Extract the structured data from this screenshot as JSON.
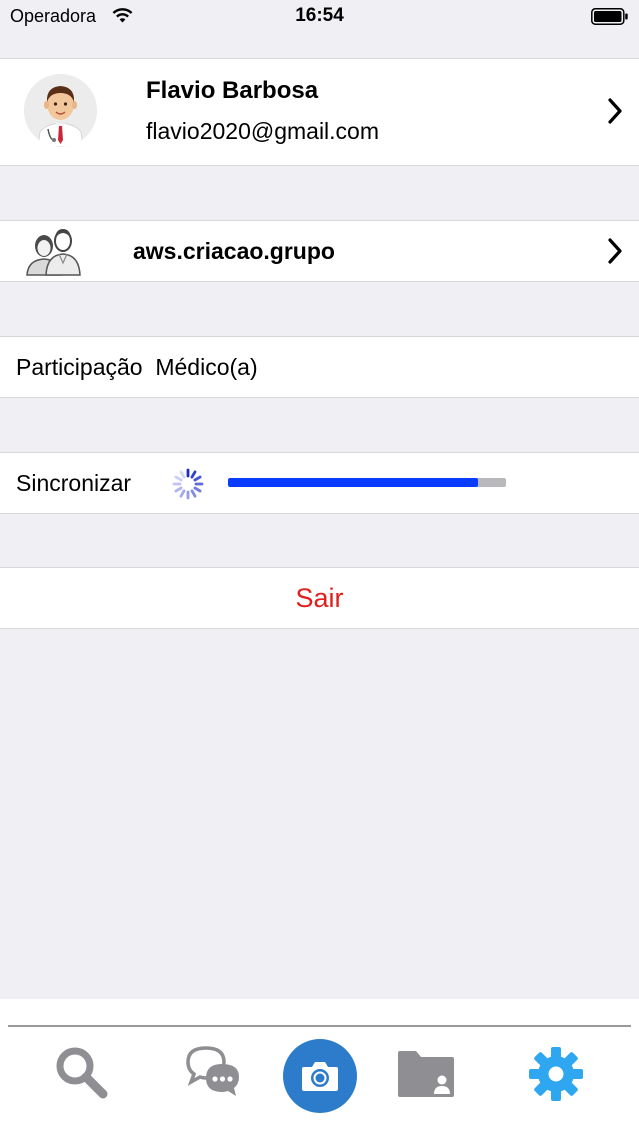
{
  "status_bar": {
    "carrier": "Operadora",
    "time": "16:54"
  },
  "profile": {
    "name": "Flavio Barbosa",
    "email": "flavio2020@gmail.com"
  },
  "group": {
    "name": "aws.criacao.grupo"
  },
  "role": {
    "label": "Participação  Médico(a)"
  },
  "sync": {
    "label": "Sincronizar",
    "progress_fraction": 0.9
  },
  "logout": {
    "label": "Sair",
    "color": "#e0201c"
  },
  "tab_bar": {
    "tabs": [
      "search-icon",
      "chat-icon",
      "camera-icon",
      "folder-contact-icon",
      "gear-icon"
    ],
    "active_tab": "gear-icon",
    "accent_color": "#2fa7f0",
    "camera_button_color": "#2d7ccb"
  },
  "colors": {
    "background": "#efeff4",
    "progress_fill": "#0a3cff",
    "progress_track": "#b9b9bd"
  }
}
